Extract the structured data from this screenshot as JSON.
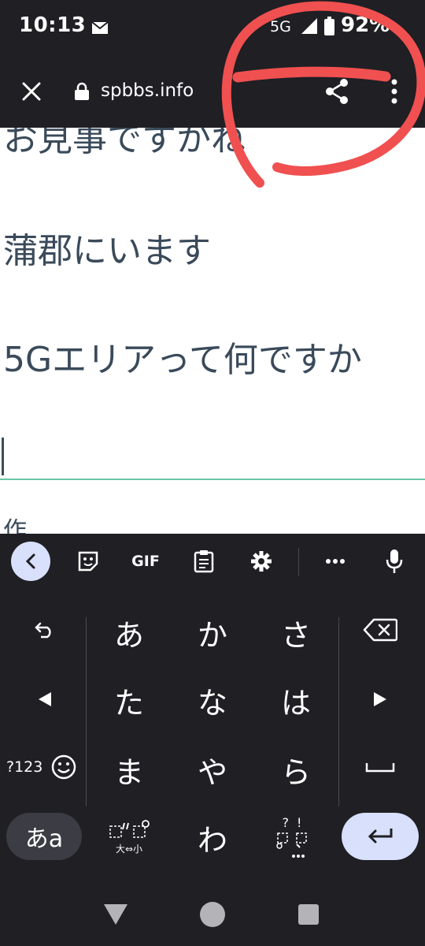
{
  "status_bar": {
    "time": "10:13",
    "network": "5G",
    "battery": "92%"
  },
  "browser": {
    "url": "spbbs.info"
  },
  "content": {
    "partial_line": "お見事ですかね",
    "messages": [
      "蒲郡にいます",
      "5Gエリアって何ですか"
    ],
    "below_input_partial": "作"
  },
  "keyboard": {
    "toolbar": {
      "gif": "GIF"
    },
    "kana_rows": [
      [
        "あ",
        "か",
        "さ"
      ],
      [
        "た",
        "な",
        "は"
      ],
      [
        "ま",
        "や",
        "ら"
      ],
      [
        "わ"
      ]
    ],
    "symbols_label": "?123",
    "mode_label": "あa",
    "dakuten_label": "大⇔小",
    "punct_label": "?!"
  },
  "colors": {
    "accent": "#6cc4a8",
    "annotation": "#f05050",
    "key_highlight": "#d8e0fb"
  }
}
